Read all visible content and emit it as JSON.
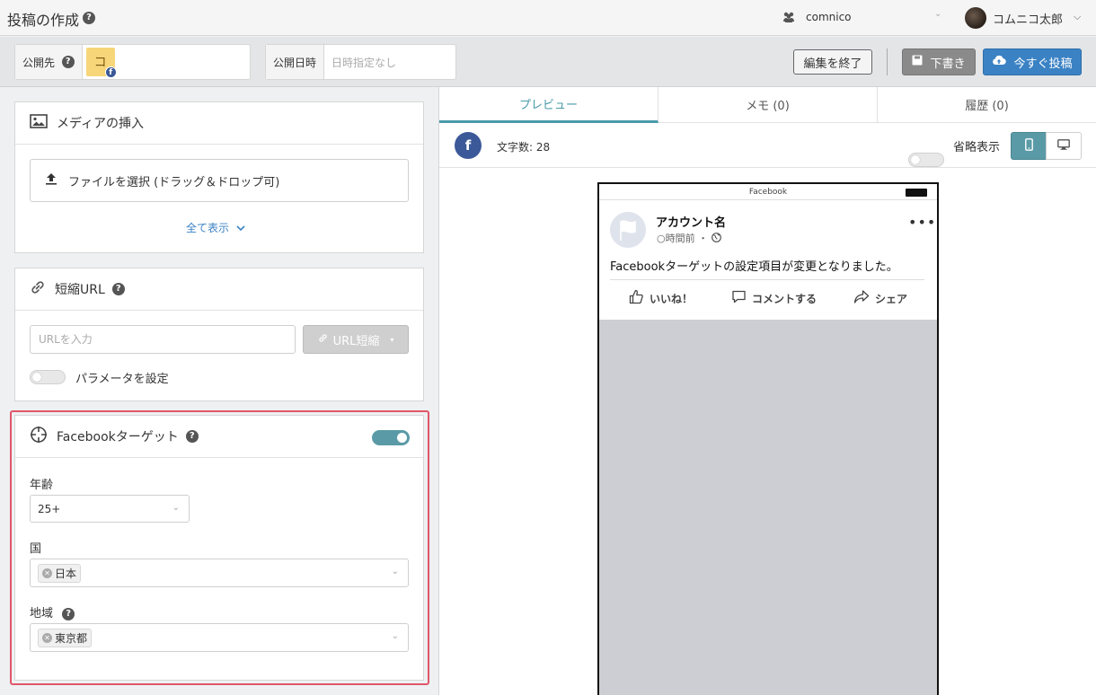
{
  "header": {
    "title": "投稿の作成",
    "workspace": "comnico",
    "user_name": "コムニコ太郎"
  },
  "toolbar": {
    "destination_label": "公開先",
    "destination_thumb_char": "コ",
    "datetime_label": "公開日時",
    "datetime_placeholder": "日時指定なし",
    "end_edit_label": "編集を終了",
    "draft_label": "下書き",
    "post_now_label": "今すぐ投稿"
  },
  "media": {
    "title": "メディアの挿入",
    "file_button": "ファイルを選択 (ドラッグ＆ドロップ可)",
    "show_all": "全て表示"
  },
  "short_url": {
    "title": "短縮URL",
    "input_placeholder": "URLを入力",
    "shorten_button": "URL短縮",
    "param_label": "パラメータを設定",
    "param_enabled": false
  },
  "fb_target": {
    "title": "Facebookターゲット",
    "enabled": true,
    "age_label": "年齢",
    "age_value": "25+",
    "country_label": "国",
    "country_tag": "日本",
    "region_label": "地域",
    "region_tag": "東京都"
  },
  "tabs": [
    {
      "label": "プレビュー",
      "active": true
    },
    {
      "label": "メモ (0)",
      "active": false
    },
    {
      "label": "履歴 (0)",
      "active": false
    }
  ],
  "preview": {
    "char_count": "文字数: 28",
    "abbrev_label": "省略表示",
    "abbrev_enabled": false,
    "device": "mobile",
    "phone_title": "Facebook",
    "account_name": "アカウント名",
    "time": "○時間前 ・",
    "post_text": "Facebookターゲットの設定項目が変更となりました。",
    "like": "いいね！",
    "comment": "コメントする",
    "share": "シェア"
  },
  "colors": {
    "accent": "#4a9aaa",
    "primary_button": "#3b82c4",
    "facebook": "#3b5998",
    "highlight_outline": "#e0566a"
  }
}
